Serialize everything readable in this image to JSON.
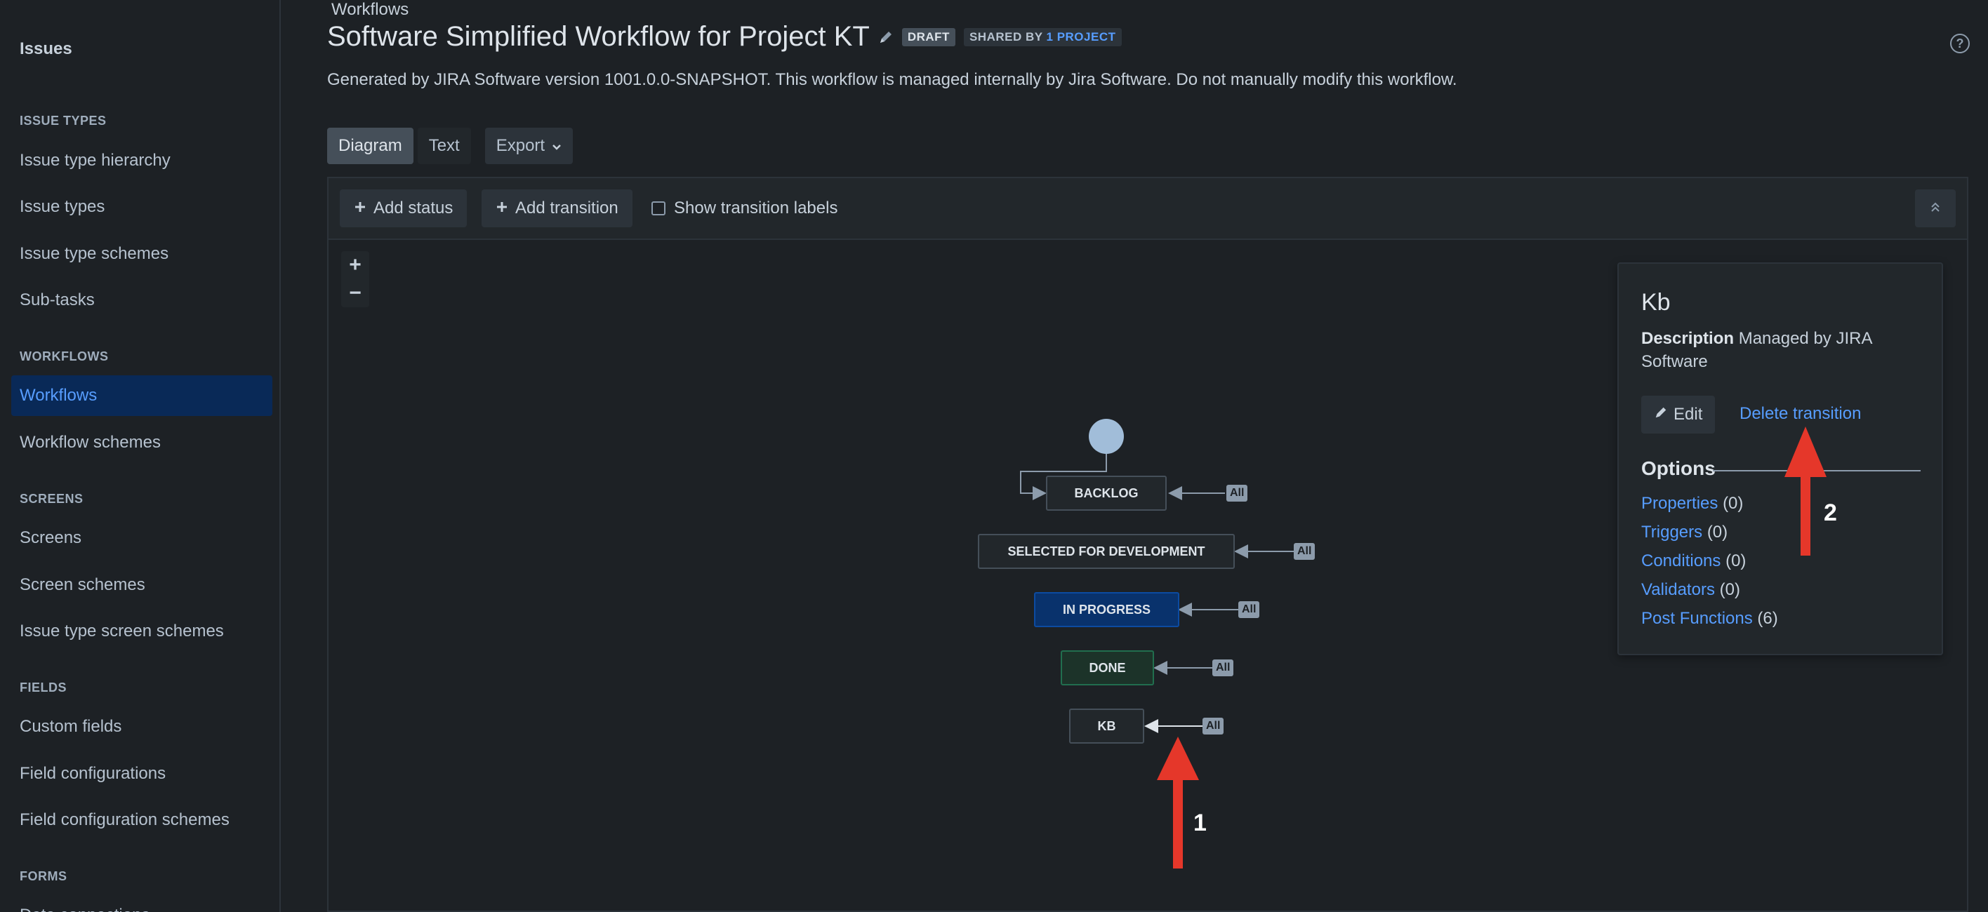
{
  "sidebar": {
    "brand": "Issues",
    "sections": [
      {
        "title": "ISSUE TYPES",
        "items": [
          "Issue type hierarchy",
          "Issue types",
          "Issue type schemes",
          "Sub-tasks"
        ]
      },
      {
        "title": "WORKFLOWS",
        "items": [
          "Workflows",
          "Workflow schemes"
        ]
      },
      {
        "title": "SCREENS",
        "items": [
          "Screens",
          "Screen schemes",
          "Issue type screen schemes"
        ]
      },
      {
        "title": "FIELDS",
        "items": [
          "Custom fields",
          "Field configurations",
          "Field configuration schemes"
        ]
      },
      {
        "title": "FORMS",
        "items": [
          "Data connections"
        ]
      }
    ],
    "active": "Workflows"
  },
  "header": {
    "breadcrumb": "Workflows",
    "title": "Software Simplified Workflow for Project KT",
    "draft_badge": "DRAFT",
    "shared_prefix": "SHARED BY",
    "shared_link": "1 PROJECT",
    "description": "Generated by JIRA Software version 1001.0.0-SNAPSHOT. This workflow is managed internally by Jira Software. Do not manually modify this workflow."
  },
  "tabs": {
    "diagram": "Diagram",
    "text": "Text",
    "export": "Export"
  },
  "toolbar": {
    "add_status": "Add status",
    "add_transition": "Add transition",
    "show_labels": "Show transition labels"
  },
  "zoom": {
    "in": "+",
    "out": "−"
  },
  "diagram": {
    "nodes": [
      "BACKLOG",
      "SELECTED FOR DEVELOPMENT",
      "IN PROGRESS",
      "DONE",
      "KB"
    ],
    "all_tag": "All"
  },
  "inspect": {
    "title": "Kb",
    "description_label": "Description",
    "description_value": "Managed by JIRA Software",
    "edit": "Edit",
    "delete": "Delete transition",
    "options_title": "Options",
    "options": [
      {
        "label": "Properties",
        "count": "(0)"
      },
      {
        "label": "Triggers",
        "count": "(0)"
      },
      {
        "label": "Conditions",
        "count": "(0)"
      },
      {
        "label": "Validators",
        "count": "(0)"
      },
      {
        "label": "Post Functions",
        "count": "(6)"
      }
    ]
  },
  "annotations": {
    "one": "1",
    "two": "2"
  },
  "colors": {
    "annotation_arrow": "#e5372a",
    "link": "#579dff",
    "active_nav_bg": "#092957"
  }
}
